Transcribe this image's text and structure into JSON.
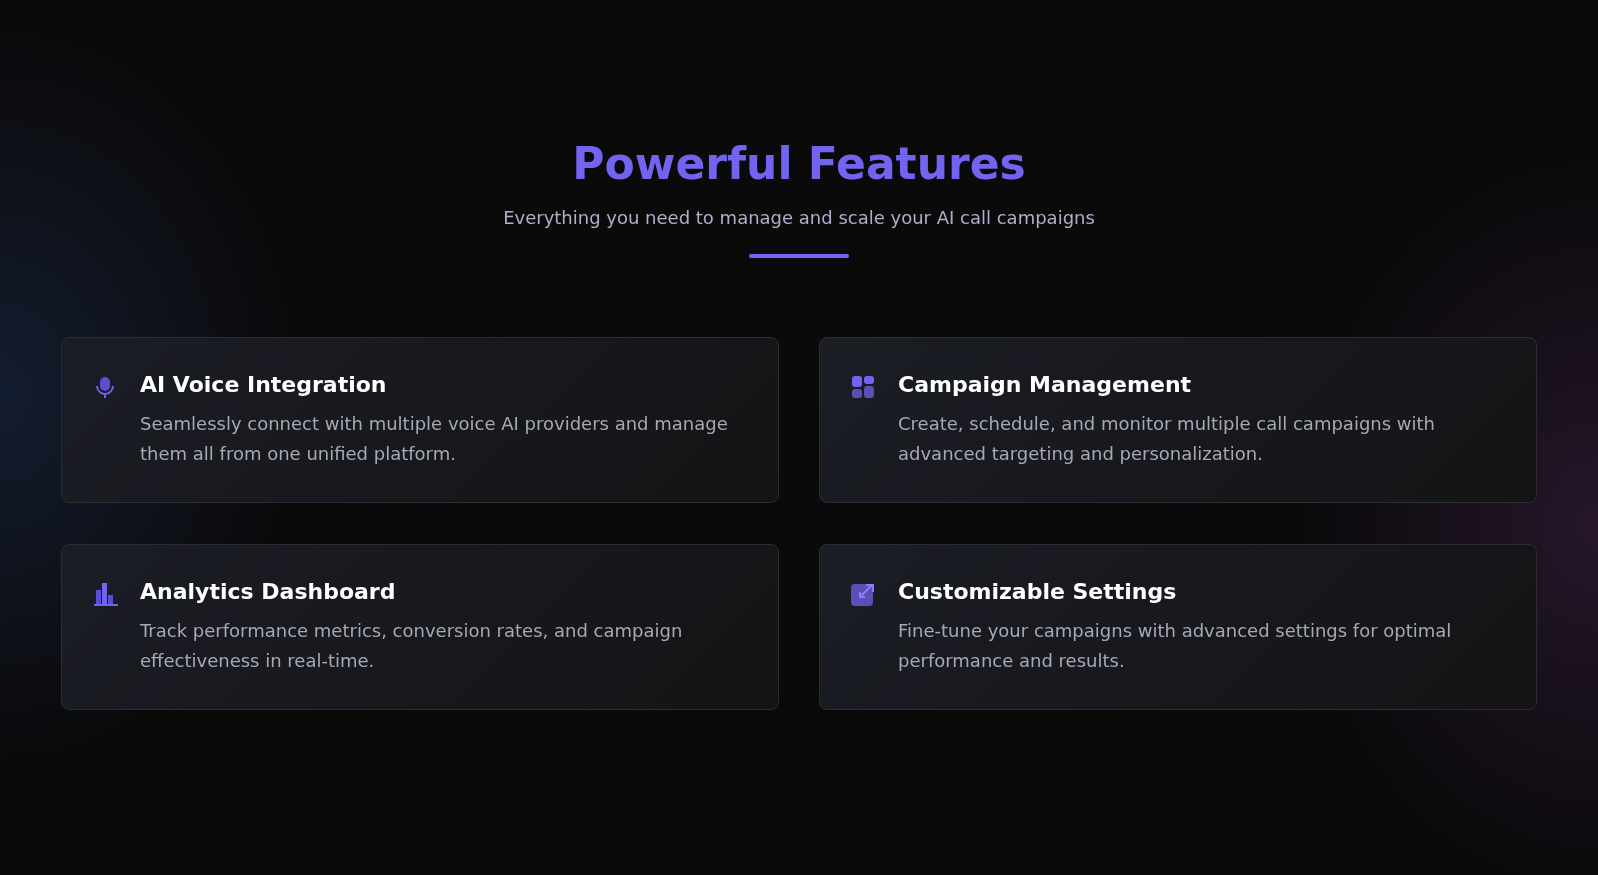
{
  "header": {
    "title": "Powerful Features",
    "subtitle": "Everything you need to manage and scale your AI call campaigns"
  },
  "features": [
    {
      "kind": "microphone",
      "title": "AI Voice Integration",
      "description": "Seamlessly connect with multiple voice AI providers and manage them all from one unified platform."
    },
    {
      "kind": "grid",
      "title": "Campaign Management",
      "description": "Create, schedule, and monitor multiple call campaigns with advanced targeting and personalization."
    },
    {
      "kind": "chart",
      "title": "Analytics Dashboard",
      "description": "Track performance metrics, conversion rates, and campaign effectiveness in real-time."
    },
    {
      "kind": "expand",
      "title": "Customizable Settings",
      "description": "Fine-tune your campaigns with advanced settings for optimal performance and results."
    }
  ]
}
